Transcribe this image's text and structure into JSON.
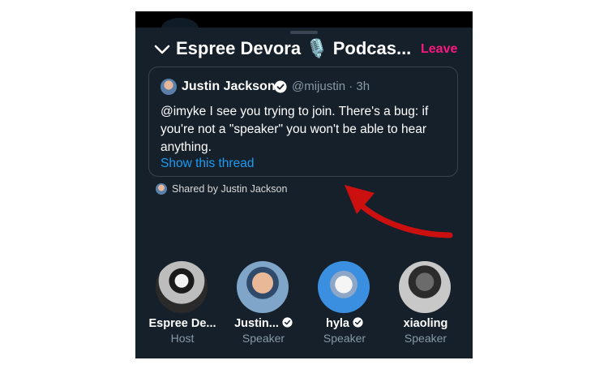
{
  "header": {
    "title": "Espree Devora 🎙️ Podcas...",
    "leave_label": "Leave"
  },
  "tweet": {
    "author_name": "Justin Jackson",
    "author_handle": "@mijustin · 3h",
    "body": "@imyke I see you trying to join. There's a bug: if you're not a \"speaker\" you won't be able to hear anything.",
    "link_label": "Show this thread"
  },
  "shared": {
    "text": "Shared by Justin Jackson"
  },
  "speakers": [
    {
      "name": "Espree De...",
      "role": "Host",
      "verified": false
    },
    {
      "name": "Justin...",
      "role": "Speaker",
      "verified": true
    },
    {
      "name": "hyla",
      "role": "Speaker",
      "verified": true
    },
    {
      "name": "xiaoling",
      "role": "Speaker",
      "verified": false
    }
  ],
  "colors": {
    "background": "#15202b",
    "accent_link": "#1d9bf0",
    "leave": "#f91880",
    "annotation_arrow": "#cc1010"
  }
}
